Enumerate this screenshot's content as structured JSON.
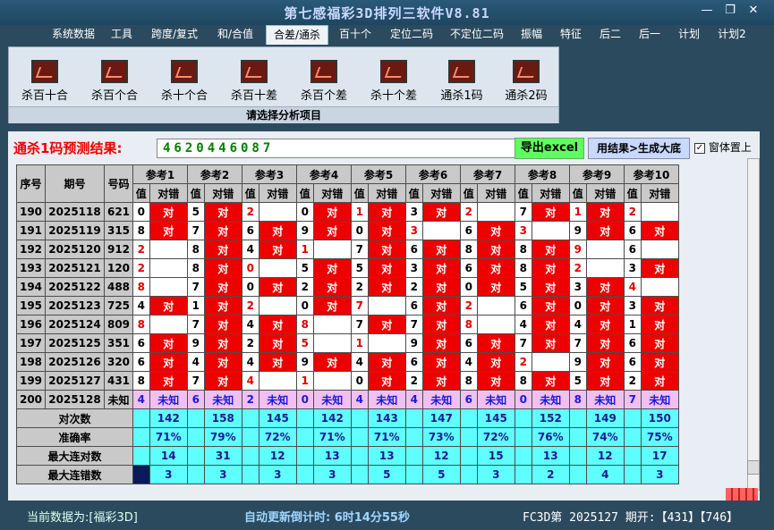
{
  "window": {
    "title": "第七感福彩3D排列三软件V8.81"
  },
  "menu": [
    "系统数据",
    "工具",
    "跨度/复式",
    "和/合值",
    "合差/通杀",
    "百十个",
    "定位二码",
    "不定位二码",
    "振幅",
    "特征",
    "后二",
    "后一",
    "计划",
    "计划2"
  ],
  "menu_active": "合差/通杀",
  "tools": [
    "杀百十合",
    "杀百个合",
    "杀十个合",
    "杀百十差",
    "杀百个差",
    "杀十个差",
    "通杀1码",
    "通杀2码"
  ],
  "panel_caption": "请选择分析项目",
  "prediction": {
    "label": "通杀1码预测结果:",
    "value": "4620446087"
  },
  "buttons": {
    "export": "导出excel",
    "generate": "用结果>生成大底"
  },
  "checkbox": {
    "label": "窗体置上",
    "checked": true
  },
  "table": {
    "headers": {
      "seq": "序号",
      "period": "期号",
      "code": "号码",
      "value": "值",
      "result": "对错"
    },
    "refs": [
      "参考1",
      "参考2",
      "参考3",
      "参考4",
      "参考5",
      "参考6",
      "参考7",
      "参考8",
      "参考9",
      "参考10"
    ],
    "rows": [
      {
        "seq": "190",
        "period": "2025118",
        "code": "621",
        "vals": [
          "0",
          "5",
          "2",
          "0",
          "1",
          "3",
          "2",
          "7",
          "1",
          "2"
        ],
        "hits": [
          "对",
          "对",
          "",
          "对",
          "对",
          "对",
          "",
          "对",
          "对",
          ""
        ],
        "bad": [
          false,
          false,
          true,
          false,
          true,
          false,
          true,
          false,
          true,
          true
        ]
      },
      {
        "seq": "191",
        "period": "2025119",
        "code": "315",
        "vals": [
          "8",
          "7",
          "6",
          "9",
          "0",
          "3",
          "6",
          "3",
          "9",
          "6"
        ],
        "hits": [
          "对",
          "对",
          "对",
          "对",
          "对",
          "",
          "对",
          "",
          "对",
          "对"
        ],
        "bad": [
          false,
          false,
          false,
          false,
          false,
          true,
          false,
          true,
          false,
          false
        ]
      },
      {
        "seq": "192",
        "period": "2025120",
        "code": "912",
        "vals": [
          "2",
          "8",
          "4",
          "1",
          "7",
          "6",
          "8",
          "8",
          "9",
          "6"
        ],
        "hits": [
          "",
          "对",
          "对",
          "",
          "对",
          "对",
          "对",
          "对",
          "",
          ""
        ],
        "bad": [
          true,
          false,
          false,
          true,
          false,
          false,
          false,
          false,
          true,
          false
        ]
      },
      {
        "seq": "193",
        "period": "2025121",
        "code": "120",
        "vals": [
          "2",
          "8",
          "0",
          "5",
          "5",
          "3",
          "6",
          "8",
          "2",
          "3"
        ],
        "hits": [
          "",
          "对",
          "",
          "对",
          "对",
          "对",
          "对",
          "对",
          "",
          "对"
        ],
        "bad": [
          true,
          false,
          true,
          false,
          false,
          false,
          false,
          false,
          true,
          false
        ]
      },
      {
        "seq": "194",
        "period": "2025122",
        "code": "488",
        "vals": [
          "8",
          "7",
          "0",
          "2",
          "2",
          "2",
          "0",
          "5",
          "3",
          "4"
        ],
        "hits": [
          "",
          "对",
          "对",
          "对",
          "对",
          "对",
          "对",
          "对",
          "对",
          ""
        ],
        "bad": [
          true,
          false,
          false,
          false,
          false,
          false,
          false,
          false,
          false,
          true
        ]
      },
      {
        "seq": "195",
        "period": "2025123",
        "code": "725",
        "vals": [
          "4",
          "1",
          "2",
          "0",
          "7",
          "6",
          "2",
          "6",
          "0",
          "3"
        ],
        "hits": [
          "对",
          "对",
          "",
          "对",
          "",
          "对",
          "",
          "对",
          "对",
          "对"
        ],
        "bad": [
          false,
          false,
          true,
          false,
          true,
          false,
          true,
          false,
          false,
          false
        ]
      },
      {
        "seq": "196",
        "period": "2025124",
        "code": "809",
        "vals": [
          "8",
          "7",
          "4",
          "8",
          "7",
          "7",
          "8",
          "4",
          "4",
          "1"
        ],
        "hits": [
          "",
          "对",
          "对",
          "",
          "对",
          "对",
          "",
          "对",
          "对",
          "对"
        ],
        "bad": [
          true,
          false,
          false,
          true,
          false,
          false,
          true,
          false,
          false,
          false
        ]
      },
      {
        "seq": "197",
        "period": "2025125",
        "code": "351",
        "vals": [
          "6",
          "9",
          "2",
          "5",
          "1",
          "9",
          "6",
          "7",
          "7",
          "6"
        ],
        "hits": [
          "对",
          "对",
          "对",
          "",
          "",
          "对",
          "对",
          "对",
          "对",
          "对"
        ],
        "bad": [
          false,
          false,
          false,
          true,
          true,
          false,
          false,
          false,
          false,
          false
        ]
      },
      {
        "seq": "198",
        "period": "2025126",
        "code": "320",
        "vals": [
          "6",
          "4",
          "4",
          "9",
          "4",
          "6",
          "4",
          "2",
          "9",
          "6"
        ],
        "hits": [
          "对",
          "对",
          "对",
          "对",
          "对",
          "对",
          "对",
          "",
          "对",
          "对"
        ],
        "bad": [
          false,
          false,
          false,
          false,
          false,
          false,
          false,
          true,
          false,
          false
        ]
      },
      {
        "seq": "199",
        "period": "2025127",
        "code": "431",
        "vals": [
          "8",
          "7",
          "4",
          "1",
          "0",
          "2",
          "8",
          "8",
          "5",
          "2"
        ],
        "hits": [
          "对",
          "对",
          "",
          "",
          "对",
          "对",
          "对",
          "对",
          "对",
          "对"
        ],
        "bad": [
          false,
          false,
          true,
          true,
          false,
          false,
          false,
          false,
          false,
          false
        ]
      }
    ],
    "current": {
      "seq": "200",
      "period": "2025128",
      "code": "未知",
      "vals": [
        "4",
        "6",
        "2",
        "0",
        "4",
        "4",
        "6",
        "0",
        "8",
        "7"
      ],
      "result": "未知"
    },
    "stats": [
      {
        "label": "对次数",
        "values": [
          "142",
          "158",
          "145",
          "142",
          "143",
          "147",
          "145",
          "152",
          "149",
          "150"
        ]
      },
      {
        "label": "准确率",
        "values": [
          "71%",
          "79%",
          "72%",
          "71%",
          "71%",
          "73%",
          "72%",
          "76%",
          "74%",
          "75%"
        ]
      },
      {
        "label": "最大连对数",
        "values": [
          "14",
          "31",
          "12",
          "13",
          "13",
          "12",
          "15",
          "13",
          "12",
          "17"
        ]
      },
      {
        "label": "最大连错数",
        "values": [
          "3",
          "3",
          "3",
          "3",
          "5",
          "5",
          "3",
          "2",
          "4",
          "3"
        ]
      }
    ]
  },
  "status": {
    "current": "当前数据为:[福彩3D]",
    "countdown": "自动更新倒计时: 6时14分55秒",
    "draw": "FC3D第 2025127 期开:【431】【746】"
  },
  "colors": {
    "hit": "#ee0000",
    "current_row": "#f1c0f0",
    "stat_cells": "#60ffff",
    "prediction_text": "#008000",
    "label_red": "#ee0000"
  }
}
